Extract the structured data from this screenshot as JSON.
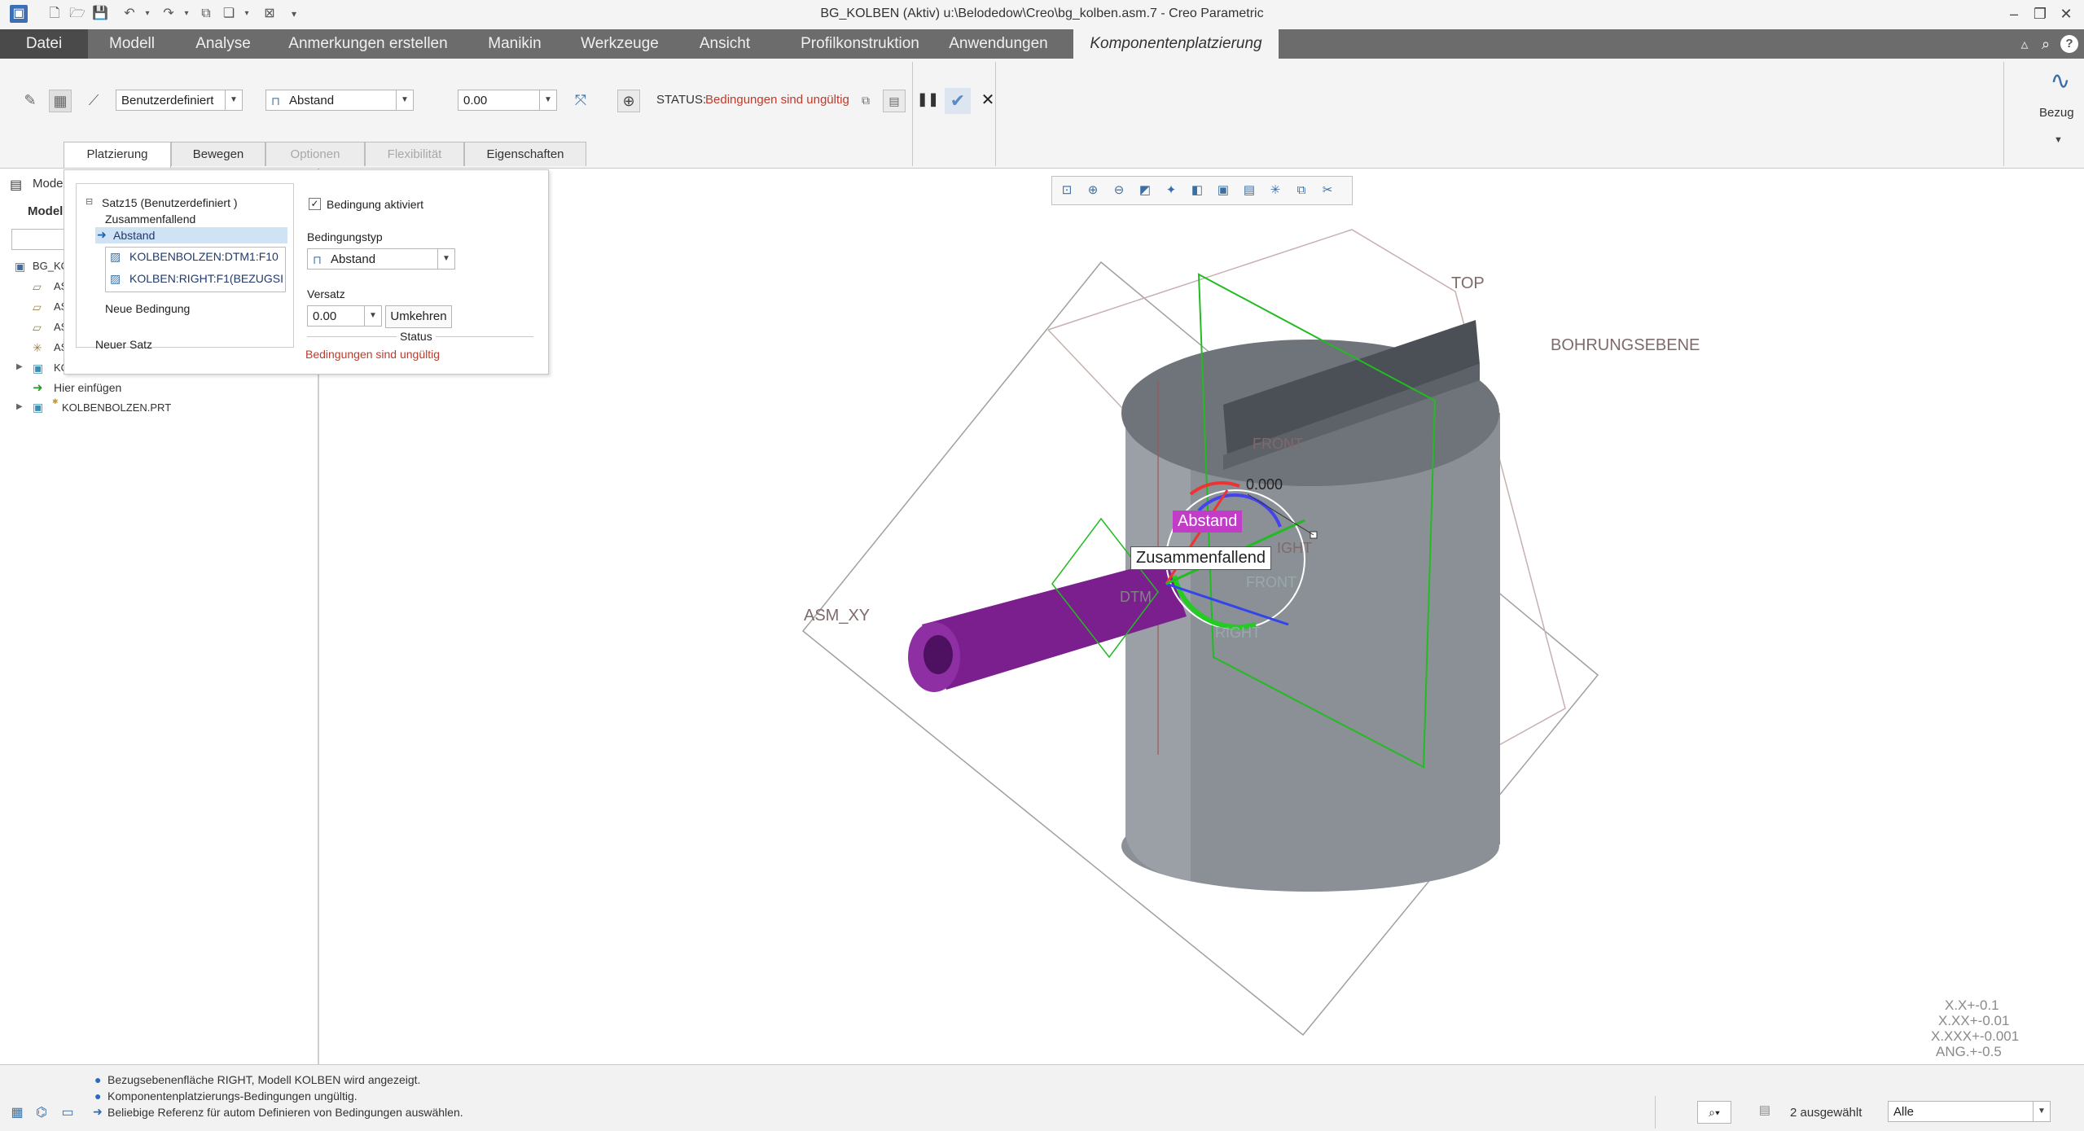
{
  "window": {
    "title": "BG_KOLBEN (Aktiv) u:\\Belodedow\\Creo\\bg_kolben.asm.7 - Creo Parametric",
    "minimize": "–",
    "restore": "❐",
    "close": "✕"
  },
  "menu": {
    "items": [
      "Datei",
      "Modell",
      "Analyse",
      "Anmerkungen erstellen",
      "Manikin",
      "Werkzeuge",
      "Ansicht",
      "Profilkonstruktion",
      "Anwendungen",
      "Komponentenplatzierung"
    ],
    "help": "?"
  },
  "ribbon": {
    "constraint_set": "Benutzerdefiniert",
    "constraint_type": "Abstand",
    "offset": "0.00",
    "status_label": "STATUS:",
    "status_value": "Bedingungen sind ungültig",
    "bezug_label": "Bezug",
    "subtabs": [
      "Platzierung",
      "Bewegen",
      "Optionen",
      "Flexibilität",
      "Eigenschaften"
    ]
  },
  "left_panel": {
    "title": "Mode",
    "section": "Model",
    "root": "BG_KO",
    "items": [
      "AS",
      "AS",
      "AS",
      "AS",
      "KO"
    ],
    "insert_here": "Hier einfügen",
    "part": "KOLBENBOLZEN.PRT"
  },
  "placement": {
    "set_title": "Satz15 (Benutzerdefiniert )",
    "constraints": [
      "Zusammenfallend",
      "Abstand"
    ],
    "references": [
      "KOLBENBOLZEN:DTM1:F10",
      "KOLBEN:RIGHT:F1(BEZUGSI"
    ],
    "new_constraint": "Neue Bedingung",
    "new_set": "Neuer Satz",
    "enabled_label": "Bedingung aktiviert",
    "type_label": "Bedingungstyp",
    "type_value": "Abstand",
    "offset_label": "Versatz",
    "offset_value": "0.00",
    "flip_label": "Umkehren",
    "status_label": "Status",
    "status_value": "Bedingungen sind ungültig"
  },
  "viewport": {
    "labels": {
      "top": "TOP",
      "bore": "BOHRUNGSEBENE",
      "front1": "FRONT",
      "front2": "FRONT",
      "right1": "IGHT",
      "right2": "RIGHT",
      "dtm": "DTM",
      "asm_xy": "ASM_XY",
      "dim": "0.000"
    },
    "tag_distance": "Abstand",
    "tag_coincident": "Zusammenfallend",
    "tolerances": [
      "X.X+-0.1",
      "X.XX+-0.01",
      "X.XXX+-0.001",
      "ANG.+-0.5"
    ]
  },
  "statusbar": {
    "messages": [
      "Bezugsebenenfläche RIGHT, Modell KOLBEN wird angezeigt.",
      "Komponentenplatzierungs-Bedingungen ungültig.",
      "Beliebige Referenz für autom Definieren von Bedingungen auswählen."
    ],
    "selected": "2 ausgewählt",
    "filter": "Alle"
  },
  "colors": {
    "menubar": "#6c6c6c",
    "error": "#c0392b",
    "pin": "#7b1f8f",
    "piston": "#8a9096",
    "datum_green": "#22bb22",
    "tag_magenta": "#c23cc8"
  }
}
